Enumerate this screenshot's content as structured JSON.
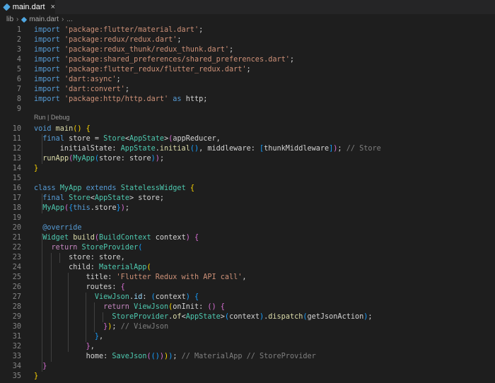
{
  "tab": {
    "label": "main.dart",
    "close": "×"
  },
  "breadcrumb": {
    "folder": "lib",
    "file": "main.dart",
    "more": "..."
  },
  "codelens": {
    "run": "Run",
    "sep": " | ",
    "debug": "Debug"
  },
  "code": {
    "lines": [
      {
        "n": "1",
        "tokens": [
          [
            "k",
            "import "
          ],
          [
            "s",
            "'package:flutter/material.dart'"
          ],
          [
            "p",
            ";"
          ]
        ]
      },
      {
        "n": "2",
        "tokens": [
          [
            "k",
            "import "
          ],
          [
            "s",
            "'package:redux/redux.dart'"
          ],
          [
            "p",
            ";"
          ]
        ]
      },
      {
        "n": "3",
        "tokens": [
          [
            "k",
            "import "
          ],
          [
            "s",
            "'package:redux_thunk/redux_thunk.dart'"
          ],
          [
            "p",
            ";"
          ]
        ]
      },
      {
        "n": "4",
        "tokens": [
          [
            "k",
            "import "
          ],
          [
            "s",
            "'package:shared_preferences/shared_preferences.dart'"
          ],
          [
            "p",
            ";"
          ]
        ]
      },
      {
        "n": "5",
        "tokens": [
          [
            "k",
            "import "
          ],
          [
            "s",
            "'package:flutter_redux/flutter_redux.dart'"
          ],
          [
            "p",
            ";"
          ]
        ]
      },
      {
        "n": "6",
        "tokens": [
          [
            "k",
            "import "
          ],
          [
            "s",
            "'dart:async'"
          ],
          [
            "p",
            ";"
          ]
        ]
      },
      {
        "n": "7",
        "tokens": [
          [
            "k",
            "import "
          ],
          [
            "s",
            "'dart:convert'"
          ],
          [
            "p",
            ";"
          ]
        ]
      },
      {
        "n": "8",
        "tokens": [
          [
            "k",
            "import "
          ],
          [
            "s",
            "'package:http/http.dart'"
          ],
          [
            "k",
            " as "
          ],
          [
            "p",
            "http;"
          ]
        ]
      },
      {
        "n": "9",
        "tokens": []
      },
      {
        "n": "10",
        "tokens": [
          [
            "k",
            "void "
          ],
          [
            "f",
            "main"
          ],
          [
            "b1",
            "()"
          ],
          [
            "p",
            " "
          ],
          [
            "b1",
            "{"
          ]
        ]
      },
      {
        "n": "11",
        "tokens": [
          [
            "p",
            "  "
          ],
          [
            "k",
            "final "
          ],
          [
            "p",
            "store = "
          ],
          [
            "t",
            "Store"
          ],
          [
            "p",
            "<"
          ],
          [
            "t",
            "AppState"
          ],
          [
            "p",
            ">"
          ],
          [
            "b2",
            "("
          ],
          [
            "p",
            "appReducer,"
          ]
        ]
      },
      {
        "n": "12",
        "tokens": [
          [
            "p",
            "      initialState: "
          ],
          [
            "t",
            "AppState"
          ],
          [
            "p",
            "."
          ],
          [
            "f",
            "initial"
          ],
          [
            "b3",
            "()"
          ],
          [
            "p",
            ", middleware: "
          ],
          [
            "b3",
            "["
          ],
          [
            "p",
            "thunkMiddleware"
          ],
          [
            "b3",
            "]"
          ],
          [
            "b2",
            ")"
          ],
          [
            "p",
            "; "
          ],
          [
            "c",
            "// Store"
          ]
        ]
      },
      {
        "n": "13",
        "tokens": [
          [
            "p",
            "  "
          ],
          [
            "f",
            "runApp"
          ],
          [
            "b2",
            "("
          ],
          [
            "t",
            "MyApp"
          ],
          [
            "b3",
            "("
          ],
          [
            "p",
            "store: store"
          ],
          [
            "b3",
            ")"
          ],
          [
            "b2",
            ")"
          ],
          [
            "p",
            ";"
          ]
        ]
      },
      {
        "n": "14",
        "tokens": [
          [
            "b1",
            "}"
          ]
        ]
      },
      {
        "n": "15",
        "tokens": []
      },
      {
        "n": "16",
        "tokens": [
          [
            "k",
            "class "
          ],
          [
            "t",
            "MyApp "
          ],
          [
            "k",
            "extends "
          ],
          [
            "t",
            "StatelessWidget "
          ],
          [
            "b1",
            "{"
          ]
        ]
      },
      {
        "n": "17",
        "tokens": [
          [
            "p",
            "  "
          ],
          [
            "k",
            "final "
          ],
          [
            "t",
            "Store"
          ],
          [
            "p",
            "<"
          ],
          [
            "t",
            "AppState"
          ],
          [
            "p",
            "> store;"
          ]
        ]
      },
      {
        "n": "18",
        "tokens": [
          [
            "p",
            "  "
          ],
          [
            "t",
            "MyApp"
          ],
          [
            "b2",
            "("
          ],
          [
            "b3",
            "{"
          ],
          [
            "k",
            "this"
          ],
          [
            "p",
            ".store"
          ],
          [
            "b3",
            "}"
          ],
          [
            "b2",
            ")"
          ],
          [
            "p",
            ";"
          ]
        ]
      },
      {
        "n": "19",
        "tokens": []
      },
      {
        "n": "20",
        "tokens": [
          [
            "p",
            "  "
          ],
          [
            "k",
            "@override"
          ]
        ]
      },
      {
        "n": "21",
        "tokens": [
          [
            "p",
            "  "
          ],
          [
            "t",
            "Widget "
          ],
          [
            "f",
            "build"
          ],
          [
            "b2",
            "("
          ],
          [
            "t",
            "BuildContext "
          ],
          [
            "p",
            "context"
          ],
          [
            "b2",
            ")"
          ],
          [
            "p",
            " "
          ],
          [
            "b2",
            "{"
          ]
        ]
      },
      {
        "n": "22",
        "tokens": [
          [
            "p",
            "    "
          ],
          [
            "kc",
            "return "
          ],
          [
            "t",
            "StoreProvider"
          ],
          [
            "b3",
            "("
          ]
        ]
      },
      {
        "n": "23",
        "tokens": [
          [
            "p",
            "        store: store,"
          ]
        ]
      },
      {
        "n": "24",
        "tokens": [
          [
            "p",
            "        child: "
          ],
          [
            "t",
            "MaterialApp"
          ],
          [
            "b1",
            "("
          ]
        ]
      },
      {
        "n": "25",
        "tokens": [
          [
            "p",
            "            title: "
          ],
          [
            "s",
            "'Flutter Redux with API call'"
          ],
          [
            "p",
            ","
          ]
        ]
      },
      {
        "n": "26",
        "tokens": [
          [
            "p",
            "            routes: "
          ],
          [
            "b2",
            "{"
          ]
        ]
      },
      {
        "n": "27",
        "tokens": [
          [
            "p",
            "              "
          ],
          [
            "t",
            "ViewJson"
          ],
          [
            "p",
            "."
          ],
          [
            "v",
            "id"
          ],
          [
            "p",
            ": "
          ],
          [
            "b3",
            "("
          ],
          [
            "p",
            "context"
          ],
          [
            "b3",
            ")"
          ],
          [
            "p",
            " "
          ],
          [
            "b3",
            "{"
          ]
        ]
      },
      {
        "n": "28",
        "tokens": [
          [
            "p",
            "                "
          ],
          [
            "kc",
            "return "
          ],
          [
            "t",
            "ViewJson"
          ],
          [
            "b1",
            "("
          ],
          [
            "p",
            "onInit: "
          ],
          [
            "b2",
            "()"
          ],
          [
            "p",
            " "
          ],
          [
            "b2",
            "{"
          ]
        ]
      },
      {
        "n": "29",
        "tokens": [
          [
            "p",
            "                  "
          ],
          [
            "t",
            "StoreProvider"
          ],
          [
            "p",
            "."
          ],
          [
            "f",
            "of"
          ],
          [
            "p",
            "<"
          ],
          [
            "t",
            "AppState"
          ],
          [
            "p",
            ">"
          ],
          [
            "b3",
            "("
          ],
          [
            "p",
            "context"
          ],
          [
            "b3",
            ")"
          ],
          [
            "p",
            "."
          ],
          [
            "f",
            "dispatch"
          ],
          [
            "b3",
            "("
          ],
          [
            "p",
            "getJsonAction"
          ],
          [
            "b3",
            ")"
          ],
          [
            "p",
            ";"
          ]
        ]
      },
      {
        "n": "30",
        "tokens": [
          [
            "p",
            "                "
          ],
          [
            "b2",
            "}"
          ],
          [
            "b1",
            ")"
          ],
          [
            "p",
            "; "
          ],
          [
            "c",
            "// ViewJson"
          ]
        ]
      },
      {
        "n": "31",
        "tokens": [
          [
            "p",
            "              "
          ],
          [
            "b3",
            "}"
          ],
          [
            "p",
            ","
          ]
        ]
      },
      {
        "n": "32",
        "tokens": [
          [
            "p",
            "            "
          ],
          [
            "b2",
            "}"
          ],
          [
            "p",
            ","
          ]
        ]
      },
      {
        "n": "33",
        "tokens": [
          [
            "p",
            "            home: "
          ],
          [
            "t",
            "SaveJson"
          ],
          [
            "b2",
            "("
          ],
          [
            "b3",
            "()"
          ],
          [
            "b2",
            ")"
          ],
          [
            "b1",
            ")"
          ],
          [
            "b3",
            ")"
          ],
          [
            "p",
            "; "
          ],
          [
            "c",
            "// MaterialApp // StoreProvider"
          ]
        ]
      },
      {
        "n": "34",
        "tokens": [
          [
            "p",
            "  "
          ],
          [
            "b2",
            "}"
          ]
        ]
      },
      {
        "n": "35",
        "tokens": [
          [
            "b1",
            "}"
          ]
        ]
      }
    ]
  }
}
